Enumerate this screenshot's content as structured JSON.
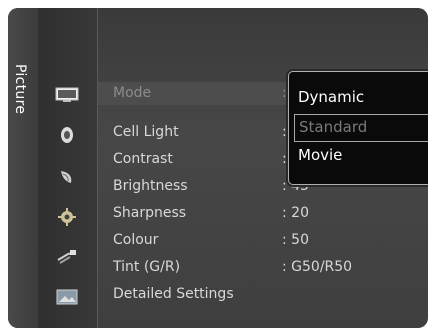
{
  "side_tab": {
    "label": "Picture"
  },
  "icons": [
    {
      "name": "picture-icon",
      "color": "#e8e8e8"
    },
    {
      "name": "sound-icon",
      "color": "#c8c8c8"
    },
    {
      "name": "channel-icon",
      "color": "#c8c8c8"
    },
    {
      "name": "setup-icon",
      "color": "#d0c090"
    },
    {
      "name": "input-icon",
      "color": "#c8c8c8"
    },
    {
      "name": "application-icon",
      "color": "#c8c8c8"
    }
  ],
  "menu": {
    "mode": {
      "label": "Mode",
      "separator": ":"
    },
    "items": [
      {
        "label": "Cell Light",
        "value": ":"
      },
      {
        "label": "Contrast",
        "value": ":"
      },
      {
        "label": "Brightness",
        "value": ": 45"
      },
      {
        "label": "Sharpness",
        "value": ": 20"
      },
      {
        "label": "Colour",
        "value": ": 50"
      },
      {
        "label": "Tint (G/R)",
        "value": ": G50/R50"
      },
      {
        "label": "Detailed Settings",
        "value": ""
      }
    ]
  },
  "dropdown": {
    "options": [
      "Dynamic",
      "Standard",
      "Movie"
    ]
  }
}
